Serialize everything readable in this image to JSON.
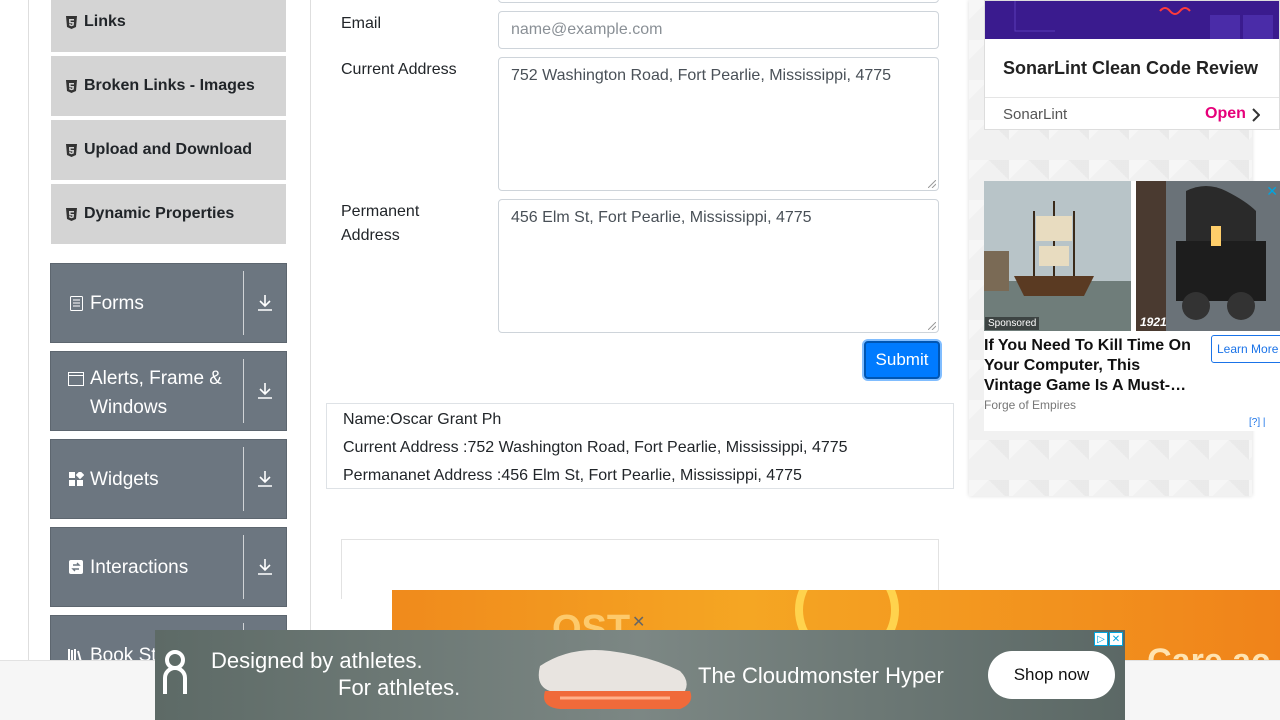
{
  "sidebar": {
    "sub_items": [
      {
        "label": "Links",
        "icon": "html5-icon"
      },
      {
        "label": "Broken Links - Images",
        "icon": "html5-icon"
      },
      {
        "label": "Upload and Download",
        "icon": "html5-icon"
      },
      {
        "label": "Dynamic Properties",
        "icon": "html5-icon"
      }
    ],
    "groups": [
      {
        "label": "Forms",
        "icon": "form-icon"
      },
      {
        "label": "Alerts, Frame & Windows",
        "icon": "window-icon"
      },
      {
        "label": "Widgets",
        "icon": "widgets-icon"
      },
      {
        "label": "Interactions",
        "icon": "interactions-icon"
      },
      {
        "label": "Book Store Application",
        "label_visible": "Book St",
        "icon": "book-icon"
      }
    ]
  },
  "form": {
    "email_label": "Email",
    "email_placeholder": "name@example.com",
    "email_value": "",
    "current_address_label": "Current Address",
    "current_address_value": "752 Washington Road, Fort Pearlie, Mississippi, 4775",
    "permanent_address_label_line1": "Permanent",
    "permanent_address_label_line2": "Address",
    "permanent_address_value": "456 Elm St, Fort Pearlie, Mississippi, 4775",
    "submit_label": "Submit"
  },
  "output": {
    "name": "Name:Oscar Grant Ph",
    "current_address": "Current Address :752 Washington Road, Fort Pearlie, Mississippi, 4775",
    "permanent_address": "Permananet Address :456 Elm St, Fort Pearlie, Mississippi, 4775"
  },
  "ads": {
    "sonar": {
      "title": "SonarLint Clean Code Review",
      "brand": "SonarLint",
      "cta": "Open",
      "accent": "#e6007a"
    },
    "sponsored": {
      "tag": "Sponsored",
      "year": "1921",
      "headline": "If You Need To Kill Time On Your Computer, This Vintage Game Is A Must-…",
      "source": "Forge of Empires",
      "cta": "Learn More",
      "adchoice": "[?]"
    },
    "on_running": {
      "line1": "Designed by athletes.",
      "line2": "For athletes.",
      "tagline": "The Cloudmonster Hyper",
      "cta": "Shop now"
    },
    "orange": {
      "text_left": "OST",
      "text_right": "Care ac"
    }
  },
  "colors": {
    "primary": "#007bff",
    "sidebar_group": "#6c7680",
    "sidebar_item": "#d4d4d4"
  }
}
